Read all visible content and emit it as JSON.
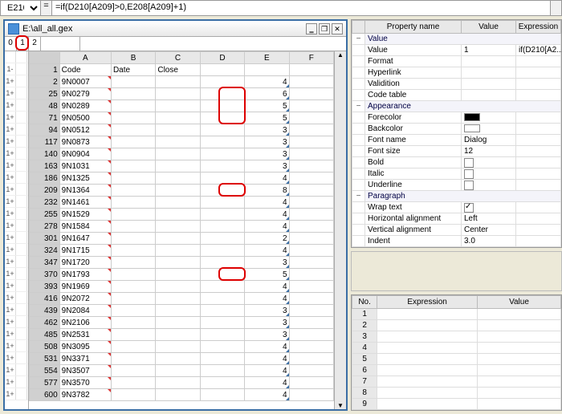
{
  "formula_bar": {
    "cell_ref": "E210",
    "eq": "=",
    "formula": "=if(D210[A209]>0,E208[A209]+1)"
  },
  "sheet_window": {
    "title_path": "E:\\all_all.gex",
    "outline_levels": [
      "0",
      "1",
      "2"
    ]
  },
  "columns": [
    "A",
    "B",
    "C",
    "D",
    "E",
    "F"
  ],
  "header_row": {
    "rownum": "1",
    "A": "Code",
    "B": "Date",
    "C": "Close",
    "D": "",
    "E": "",
    "F": ""
  },
  "rows": [
    {
      "tog": "1+",
      "n": "2",
      "A": "9N0007",
      "E": "4"
    },
    {
      "tog": "1+",
      "n": "25",
      "A": "9N0279",
      "E": "6",
      "hlE": true
    },
    {
      "tog": "1+",
      "n": "48",
      "A": "9N0289",
      "E": "5",
      "hlE": true
    },
    {
      "tog": "1+",
      "n": "71",
      "A": "9N0500",
      "E": "5",
      "hlE": true
    },
    {
      "tog": "1+",
      "n": "94",
      "A": "9N0512",
      "E": "3"
    },
    {
      "tog": "1+",
      "n": "117",
      "A": "9N0873",
      "E": "3"
    },
    {
      "tog": "1+",
      "n": "140",
      "A": "9N0904",
      "E": "3"
    },
    {
      "tog": "1+",
      "n": "163",
      "A": "9N1031",
      "E": "3"
    },
    {
      "tog": "1+",
      "n": "186",
      "A": "9N1325",
      "E": "4"
    },
    {
      "tog": "1+",
      "n": "209",
      "A": "9N1364",
      "E": "8",
      "hlE": true,
      "solo": true
    },
    {
      "tog": "1+",
      "n": "232",
      "A": "9N1461",
      "E": "4"
    },
    {
      "tog": "1+",
      "n": "255",
      "A": "9N1529",
      "E": "4"
    },
    {
      "tog": "1+",
      "n": "278",
      "A": "9N1584",
      "E": "4"
    },
    {
      "tog": "1+",
      "n": "301",
      "A": "9N1647",
      "E": "2"
    },
    {
      "tog": "1+",
      "n": "324",
      "A": "9N1715",
      "E": "4"
    },
    {
      "tog": "1+",
      "n": "347",
      "A": "9N1720",
      "E": "3"
    },
    {
      "tog": "1+",
      "n": "370",
      "A": "9N1793",
      "E": "5",
      "hlE": true,
      "solo": true
    },
    {
      "tog": "1+",
      "n": "393",
      "A": "9N1969",
      "E": "4"
    },
    {
      "tog": "1+",
      "n": "416",
      "A": "9N2072",
      "E": "4"
    },
    {
      "tog": "1+",
      "n": "439",
      "A": "9N2084",
      "E": "3"
    },
    {
      "tog": "1+",
      "n": "462",
      "A": "9N2106",
      "E": "3"
    },
    {
      "tog": "1+",
      "n": "485",
      "A": "9N2531",
      "E": "3"
    },
    {
      "tog": "1+",
      "n": "508",
      "A": "9N3095",
      "E": "4"
    },
    {
      "tog": "1+",
      "n": "531",
      "A": "9N3371",
      "E": "4"
    },
    {
      "tog": "1+",
      "n": "554",
      "A": "9N3507",
      "E": "4"
    },
    {
      "tog": "1+",
      "n": "577",
      "A": "9N3570",
      "E": "4"
    },
    {
      "tog": "1+",
      "n": "600",
      "A": "9N3782",
      "E": "4"
    }
  ],
  "properties": {
    "headers": [
      "",
      "Property name",
      "Value",
      "Expression"
    ],
    "rows": [
      {
        "type": "group",
        "twisty": "−",
        "name": "Value"
      },
      {
        "type": "prop",
        "name": "Value",
        "value": "1",
        "expr": "if(D210[A2..."
      },
      {
        "type": "prop",
        "name": "Format",
        "value": ""
      },
      {
        "type": "prop",
        "name": "Hyperlink",
        "value": ""
      },
      {
        "type": "prop",
        "name": "Validition",
        "value": ""
      },
      {
        "type": "prop",
        "name": "Code table",
        "value": ""
      },
      {
        "type": "group",
        "twisty": "−",
        "name": "Appearance"
      },
      {
        "type": "prop",
        "name": "Forecolor",
        "value": "swatch-black"
      },
      {
        "type": "prop",
        "name": "Backcolor",
        "value": "swatch-white"
      },
      {
        "type": "prop",
        "name": "Font name",
        "value": "Dialog"
      },
      {
        "type": "prop",
        "name": "Font size",
        "value": "12"
      },
      {
        "type": "prop",
        "name": "Bold",
        "value": "checkbox"
      },
      {
        "type": "prop",
        "name": "Italic",
        "value": "checkbox"
      },
      {
        "type": "prop",
        "name": "Underline",
        "value": "checkbox"
      },
      {
        "type": "group",
        "twisty": "−",
        "name": "Paragraph"
      },
      {
        "type": "prop",
        "name": "Wrap text",
        "value": "checkbox-checked"
      },
      {
        "type": "prop",
        "name": "Horizontal alignment",
        "value": "   Left"
      },
      {
        "type": "prop",
        "name": "Vertical alignment",
        "value": "   Center"
      },
      {
        "type": "prop",
        "name": "Indent",
        "value": "3.0"
      }
    ]
  },
  "expressions": {
    "headers": [
      "No.",
      "Expression",
      "Value"
    ],
    "rows": [
      1,
      2,
      3,
      4,
      5,
      6,
      7,
      8,
      9
    ]
  }
}
